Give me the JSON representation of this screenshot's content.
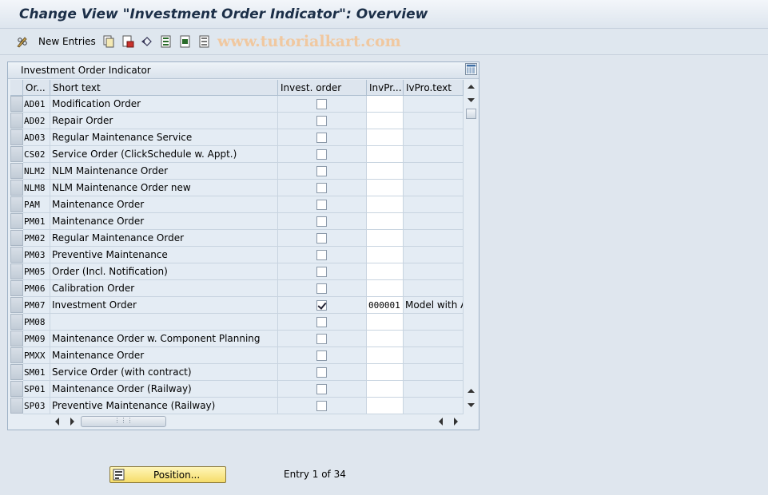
{
  "window": {
    "title": "Change View \"Investment Order Indicator\": Overview"
  },
  "toolbar": {
    "new_entries_label": "New Entries",
    "watermark": "www.tutorialkart.com"
  },
  "table": {
    "title": "Investment Order Indicator",
    "columns": {
      "order_type": "Or...",
      "short_text": "Short text",
      "invest_order": "Invest. order",
      "inv_profile": "InvPr...",
      "inv_profile_text": "IvPro.text"
    },
    "rows": [
      {
        "order_type": "AD01",
        "short_text": "Modification Order",
        "invest_order": false,
        "inv_profile": "",
        "inv_profile_text": ""
      },
      {
        "order_type": "AD02",
        "short_text": "Repair Order",
        "invest_order": false,
        "inv_profile": "",
        "inv_profile_text": ""
      },
      {
        "order_type": "AD03",
        "short_text": "Regular Maintenance Service",
        "invest_order": false,
        "inv_profile": "",
        "inv_profile_text": ""
      },
      {
        "order_type": "CS02",
        "short_text": "Service Order (ClickSchedule w. Appt.)",
        "invest_order": false,
        "inv_profile": "",
        "inv_profile_text": ""
      },
      {
        "order_type": "NLM2",
        "short_text": "NLM Maintenance Order",
        "invest_order": false,
        "inv_profile": "",
        "inv_profile_text": ""
      },
      {
        "order_type": "NLM8",
        "short_text": "NLM Maintenance Order new",
        "invest_order": false,
        "inv_profile": "",
        "inv_profile_text": ""
      },
      {
        "order_type": "PAM",
        "short_text": "Maintenance Order",
        "invest_order": false,
        "inv_profile": "",
        "inv_profile_text": ""
      },
      {
        "order_type": "PM01",
        "short_text": "Maintenance Order",
        "invest_order": false,
        "inv_profile": "",
        "inv_profile_text": ""
      },
      {
        "order_type": "PM02",
        "short_text": "Regular Maintenance Order",
        "invest_order": false,
        "inv_profile": "",
        "inv_profile_text": ""
      },
      {
        "order_type": "PM03",
        "short_text": "Preventive Maintenance",
        "invest_order": false,
        "inv_profile": "",
        "inv_profile_text": ""
      },
      {
        "order_type": "PM05",
        "short_text": "Order (Incl. Notification)",
        "invest_order": false,
        "inv_profile": "",
        "inv_profile_text": ""
      },
      {
        "order_type": "PM06",
        "short_text": "Calibration Order",
        "invest_order": false,
        "inv_profile": "",
        "inv_profile_text": ""
      },
      {
        "order_type": "PM07",
        "short_text": "Investment Order",
        "invest_order": true,
        "inv_profile": "000001",
        "inv_profile_text": "Model with A"
      },
      {
        "order_type": "PM08",
        "short_text": "",
        "invest_order": false,
        "inv_profile": "",
        "inv_profile_text": ""
      },
      {
        "order_type": "PM09",
        "short_text": "Maintenance Order w. Component Planning",
        "invest_order": false,
        "inv_profile": "",
        "inv_profile_text": ""
      },
      {
        "order_type": "PMXX",
        "short_text": "Maintenance Order",
        "invest_order": false,
        "inv_profile": "",
        "inv_profile_text": ""
      },
      {
        "order_type": "SM01",
        "short_text": "Service Order (with contract)",
        "invest_order": false,
        "inv_profile": "",
        "inv_profile_text": ""
      },
      {
        "order_type": "SP01",
        "short_text": "Maintenance Order (Railway)",
        "invest_order": false,
        "inv_profile": "",
        "inv_profile_text": ""
      },
      {
        "order_type": "SP03",
        "short_text": "Preventive Maintenance (Railway)",
        "invest_order": false,
        "inv_profile": "",
        "inv_profile_text": ""
      }
    ]
  },
  "footer": {
    "position_button_label": "Position...",
    "entry_info": "Entry 1 of 34"
  },
  "icons": {
    "toolbar": [
      "pen-glasses-icon",
      "copy-icon",
      "delete-icon",
      "undo-icon",
      "select-all-icon",
      "select-block-icon",
      "deselect-all-icon"
    ],
    "table_settings": "table-settings-icon",
    "position": "position-icon"
  },
  "colors": {
    "title_text": "#1c2f48",
    "button_yellow": "#f5dc6a",
    "watermark": "#f0c8a0"
  }
}
